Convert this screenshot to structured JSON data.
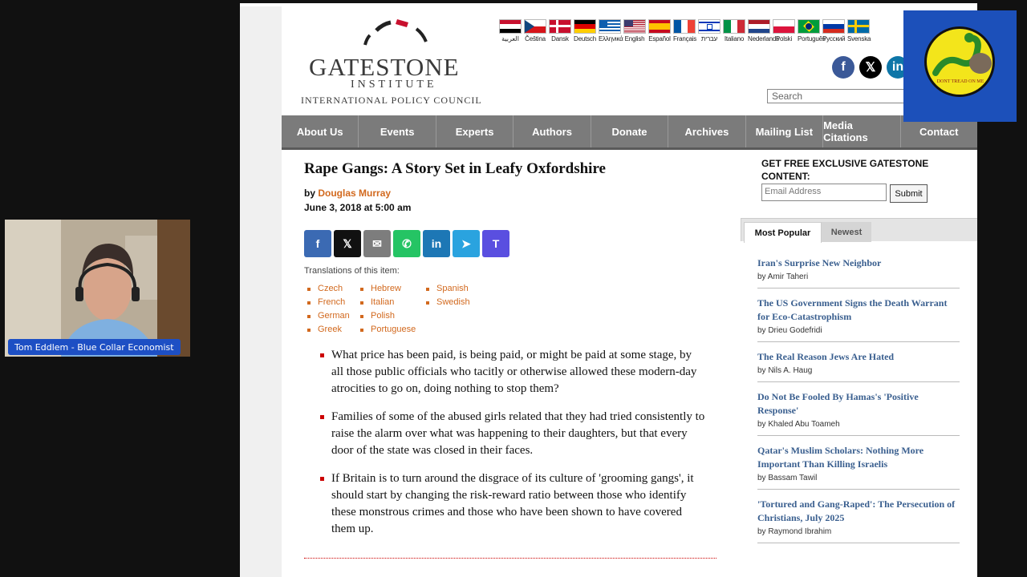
{
  "header": {
    "logo_word": "GATESTONE",
    "logo_institute": "INSTITUTE",
    "logo_council": "INTERNATIONAL POLICY COUNCIL",
    "search_placeholder": "Search"
  },
  "flags": [
    {
      "label": "العربية",
      "icon": "flag-egypt"
    },
    {
      "label": "Čeština",
      "icon": "flag-czech"
    },
    {
      "label": "Dansk",
      "icon": "flag-denmark"
    },
    {
      "label": "Deutsch",
      "icon": "flag-germany"
    },
    {
      "label": "Ελληνικά",
      "icon": "flag-greece"
    },
    {
      "label": "English",
      "icon": "flag-usa"
    },
    {
      "label": "Español",
      "icon": "flag-spain"
    },
    {
      "label": "Français",
      "icon": "flag-france"
    },
    {
      "label": "עברית",
      "icon": "flag-israel"
    },
    {
      "label": "Italiano",
      "icon": "flag-italy"
    },
    {
      "label": "Nederlands",
      "icon": "flag-netherlands"
    },
    {
      "label": "Polski",
      "icon": "flag-poland"
    },
    {
      "label": "Português",
      "icon": "flag-brazil"
    },
    {
      "label": "Русский",
      "icon": "flag-russia"
    },
    {
      "label": "Svenska",
      "icon": "flag-sweden"
    }
  ],
  "social": [
    {
      "glyph": "f",
      "icon": "facebook-icon",
      "color": "#3b5998"
    },
    {
      "glyph": "𝕏",
      "icon": "x-icon",
      "color": "#000000"
    },
    {
      "glyph": "in",
      "icon": "linkedin-icon",
      "color": "#0e76a8"
    }
  ],
  "nav": [
    "About Us",
    "Events",
    "Experts",
    "Authors",
    "Donate",
    "Archives",
    "Mailing List",
    "Media Citations",
    "Contact"
  ],
  "article": {
    "title": "Rape Gangs: A Story Set in Leafy Oxfordshire",
    "by": "by",
    "author": "Douglas Murray",
    "date": "June 3, 2018 at 5:00 am",
    "shares": [
      {
        "glyph": "f",
        "icon": "facebook-share-icon",
        "color": "#3b6ab3"
      },
      {
        "glyph": "𝕏",
        "icon": "x-share-icon",
        "color": "#111111"
      },
      {
        "glyph": "✉",
        "icon": "email-share-icon",
        "color": "#7d7d7d"
      },
      {
        "glyph": "✆",
        "icon": "whatsapp-share-icon",
        "color": "#25c464"
      },
      {
        "glyph": "in",
        "icon": "linkedin-share-icon",
        "color": "#1d77b5"
      },
      {
        "glyph": "➤",
        "icon": "telegram-share-icon",
        "color": "#2aa3df"
      },
      {
        "glyph": "T",
        "icon": "truth-share-icon",
        "color": "#5a4fe0"
      }
    ],
    "translations_title": "Translations of this item:",
    "translations": [
      "Czech",
      "Hebrew",
      "Spanish",
      "French",
      "Italian",
      "Swedish",
      "German",
      "Polish",
      "",
      "Greek",
      "Portuguese",
      ""
    ],
    "bullets": [
      "What price has been paid, is being paid, or might be paid at some stage, by all those public officials who tacitly or otherwise allowed these modern-day atrocities to go on, doing nothing to stop them?",
      "Families of some of the abused girls related that they had tried consistently to raise the alarm over what was happening to their daughters, but that every door of the state was closed in their faces.",
      "If Britain is to turn around the disgrace of its culture of 'grooming gangs', it should start by changing the risk-reward ratio between those who identify these monstrous crimes and those who have been shown to have covered them up."
    ]
  },
  "sidebar": {
    "getfree": "GET FREE EXCLUSIVE GATESTONE CONTENT:",
    "email_placeholder": "Email Address",
    "submit": "Submit",
    "tab_popular": "Most Popular",
    "tab_newest": "Newest",
    "popular": [
      {
        "title": "Iran's Surprise New Neighbor",
        "author": "by Amir Taheri"
      },
      {
        "title": "The US Government Signs the Death Warrant for Eco-Catastrophism",
        "author": "by Drieu Godefridi"
      },
      {
        "title": "The Real Reason Jews Are Hated",
        "author": "by Nils A. Haug"
      },
      {
        "title": "Do Not Be Fooled By Hamas's 'Positive Response'",
        "author": "by Khaled Abu Toameh"
      },
      {
        "title": "Qatar's Muslim Scholars: Nothing More Important Than Killing Israelis",
        "author": "by Bassam Tawil"
      },
      {
        "title": "'Tortured and Gang-Raped': The Persecution of Christians, July 2025",
        "author": "by Raymond Ibrahim"
      }
    ]
  },
  "overlay": {
    "webcam_label": "Tom Eddlem - Blue Collar Economist",
    "badge_text": "DONT TREAD ON ME"
  }
}
